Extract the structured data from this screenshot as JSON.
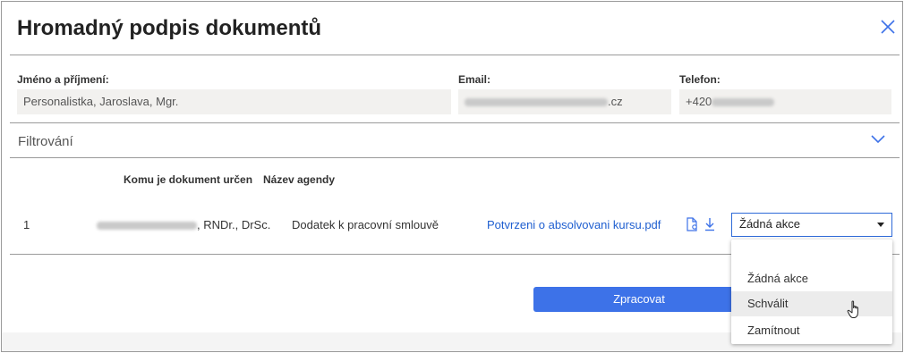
{
  "dialog": {
    "title": "Hromadný podpis dokumentů",
    "close_icon": "close-icon"
  },
  "contact": {
    "name_label": "Jméno a příjmení:",
    "name_value": "Personalistka, Jaroslava, Mgr.",
    "email_label": "Email:",
    "email_suffix": ".cz",
    "phone_label": "Telefon:",
    "phone_prefix": "+420"
  },
  "filter": {
    "label": "Filtrování",
    "toggle_icon": "chevron-down-icon"
  },
  "table": {
    "headers": [
      "Komu je dokument určen",
      "Název agendy"
    ],
    "rows": [
      {
        "index": "1",
        "recipient_suffix": ", RNDr., DrSc.",
        "agenda": "Dodatek k pracovní smlouvě",
        "file": "Potvrzeni o absolvovani kursu.pdf",
        "action": "Žádná akce"
      }
    ]
  },
  "actions": {
    "process_label": "Zpracovat"
  },
  "dropdown": {
    "options": [
      "Žádná akce",
      "Schválit",
      "Zamítnout"
    ],
    "hovered": "Schválit"
  },
  "colors": {
    "accent": "#3d72e8",
    "link": "#1f5fd0",
    "field_bg": "#f2f1ef"
  }
}
